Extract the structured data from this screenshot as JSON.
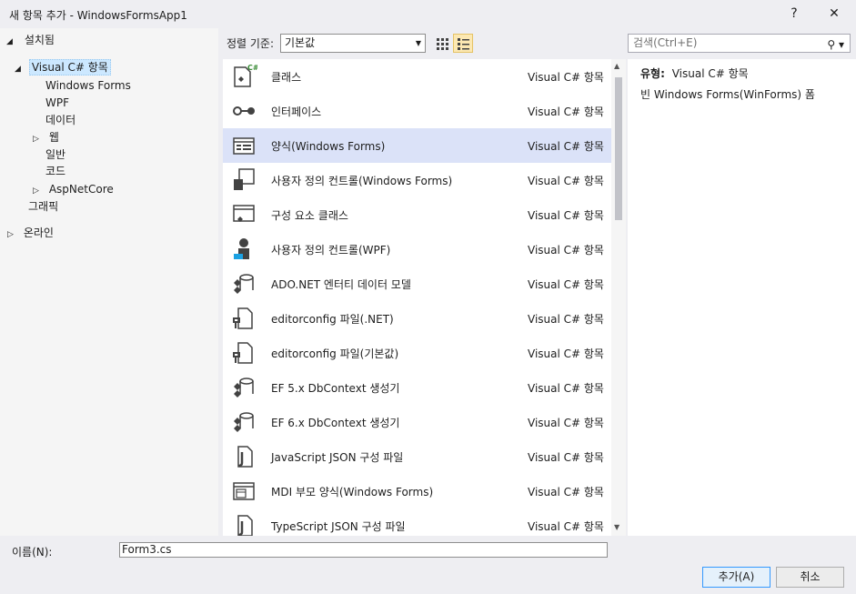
{
  "window": {
    "title": "새 항목 추가 - WindowsFormsApp1",
    "help": "?",
    "close": "✕"
  },
  "tree": {
    "installed": "설치됨",
    "visual_cs": "Visual C# 항목",
    "windows_forms": "Windows Forms",
    "wpf": "WPF",
    "data": "데이터",
    "web": "웹",
    "general": "일반",
    "code": "코드",
    "aspnetcore": "AspNetCore",
    "graphics": "그래픽",
    "online": "온라인"
  },
  "toolbar": {
    "sort_label": "정렬 기준:",
    "sort_value": "기본값",
    "search_placeholder": "검색(Ctrl+E)"
  },
  "items": [
    {
      "name": "클래스",
      "cat": "Visual C# 항목",
      "icon": "class-icon"
    },
    {
      "name": "인터페이스",
      "cat": "Visual C# 항목",
      "icon": "interface-icon"
    },
    {
      "name": "양식(Windows Forms)",
      "cat": "Visual C# 항목",
      "icon": "form-icon"
    },
    {
      "name": "사용자 정의 컨트롤(Windows Forms)",
      "cat": "Visual C# 항목",
      "icon": "user-control-icon"
    },
    {
      "name": "구성 요소 클래스",
      "cat": "Visual C# 항목",
      "icon": "component-icon"
    },
    {
      "name": "사용자 정의 컨트롤(WPF)",
      "cat": "Visual C# 항목",
      "icon": "wpf-control-icon"
    },
    {
      "name": "ADO.NET 엔터티 데이터 모델",
      "cat": "Visual C# 항목",
      "icon": "data-model-icon"
    },
    {
      "name": "editorconfig 파일(.NET)",
      "cat": "Visual C# 항목",
      "icon": "config-file-icon"
    },
    {
      "name": "editorconfig 파일(기본값)",
      "cat": "Visual C# 항목",
      "icon": "config-file-icon"
    },
    {
      "name": "EF 5.x DbContext 생성기",
      "cat": "Visual C# 항목",
      "icon": "ef-generator-icon"
    },
    {
      "name": "EF 6.x DbContext 생성기",
      "cat": "Visual C# 항목",
      "icon": "ef-generator-icon"
    },
    {
      "name": "JavaScript JSON 구성 파일",
      "cat": "Visual C# 항목",
      "icon": "json-file-icon"
    },
    {
      "name": "MDI 부모 양식(Windows Forms)",
      "cat": "Visual C# 항목",
      "icon": "mdi-form-icon"
    },
    {
      "name": "TypeScript JSON 구성 파일",
      "cat": "Visual C# 항목",
      "icon": "json-file-icon"
    }
  ],
  "info": {
    "type_label": "유형:",
    "type_value": "Visual C# 항목",
    "description": "빈 Windows Forms(WinForms) 폼"
  },
  "bottom": {
    "name_label": "이름(N):",
    "name_value": "Form3.cs",
    "add_button": "추가(A)",
    "cancel_button": "취소"
  }
}
